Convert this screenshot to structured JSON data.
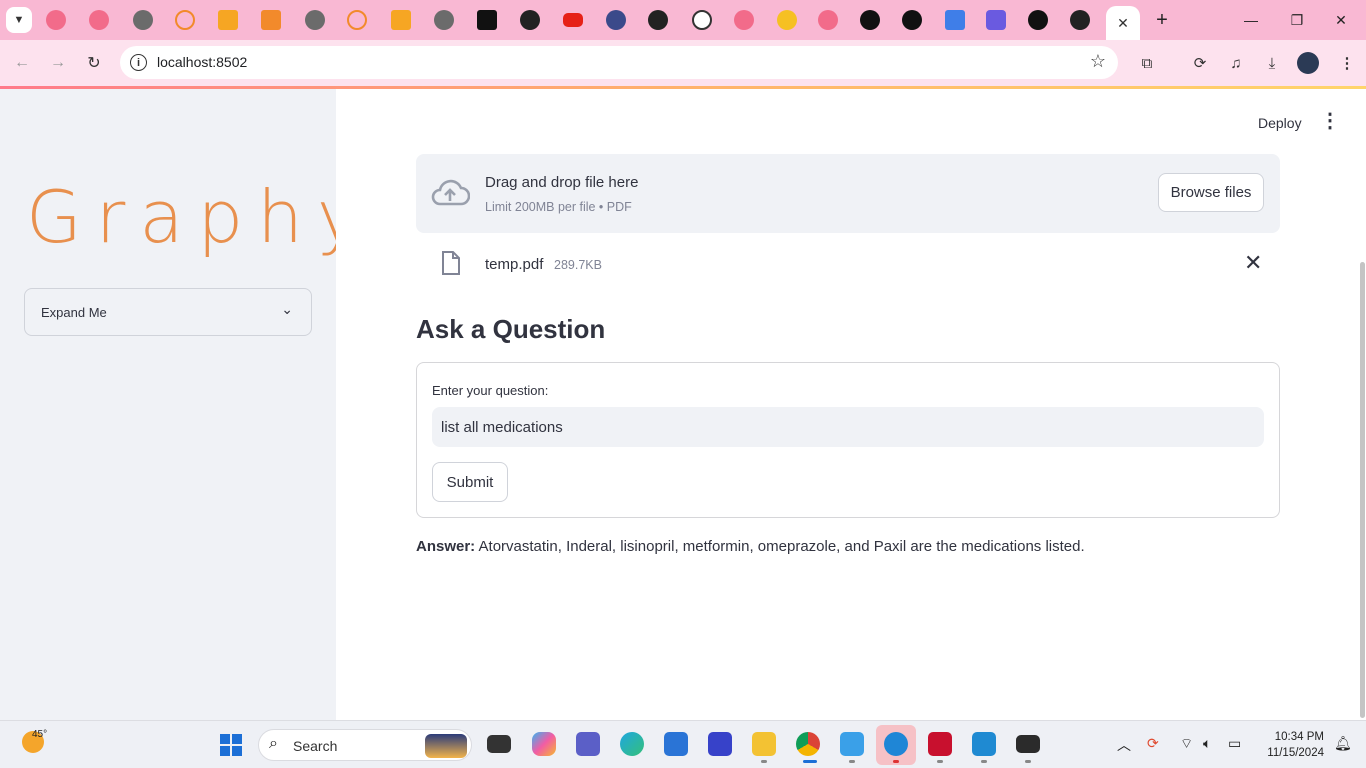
{
  "browser": {
    "url": "localhost:8502",
    "active_tab_close": "✕",
    "new_tab": "+"
  },
  "sidebar": {
    "logo_text": "Graphy",
    "expander_label": "Expand Me"
  },
  "header": {
    "deploy_label": "Deploy"
  },
  "uploader": {
    "drag_text": "Drag and drop file here",
    "limit_text": "Limit 200MB per file • PDF",
    "browse_label": "Browse files",
    "file_name": "temp.pdf",
    "file_size": "289.7KB"
  },
  "question": {
    "heading": "Ask a Question",
    "input_label": "Enter your question:",
    "input_value": "list all medications",
    "submit_label": "Submit"
  },
  "answer": {
    "prefix": "Answer:",
    "text": " Atorvastatin, Inderal, lisinopril, metformin, omeprazole, and Paxil are the medications listed."
  },
  "taskbar": {
    "temperature": "45°",
    "search_label": "Search",
    "time": "10:34 PM",
    "date": "11/15/2024"
  },
  "colors": {
    "tab_strip": "#f9b8d3",
    "toolbar": "#fde2ee",
    "logo": "#e8904e",
    "sidebar_bg": "#f0f2f6",
    "text": "#31333f"
  }
}
